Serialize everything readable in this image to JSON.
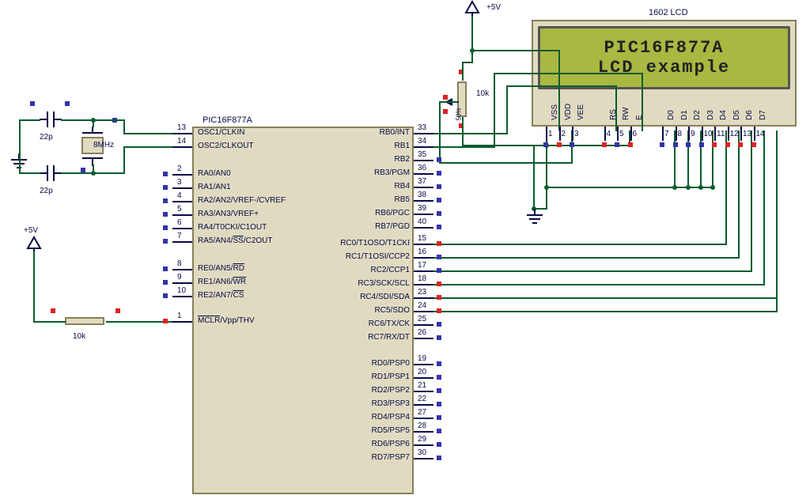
{
  "power": {
    "v5": "+5V"
  },
  "mcu": {
    "title": "PIC16F877A",
    "left_block1": [
      {
        "num": "13",
        "label": "OSC1/CLKIN"
      },
      {
        "num": "14",
        "label": "OSC2/CLKOUT"
      }
    ],
    "left_block2": [
      {
        "num": "2",
        "label": "RA0/AN0"
      },
      {
        "num": "3",
        "label": "RA1/AN1"
      },
      {
        "num": "4",
        "label": "RA2/AN2/VREF-/CVREF"
      },
      {
        "num": "5",
        "label": "RA3/AN3/VREF+"
      },
      {
        "num": "6",
        "label": "RA4/T0CKI/C1OUT"
      },
      {
        "num": "7",
        "label": "RA5/AN4/SS/C2OUT",
        "ss_over": "SS"
      }
    ],
    "left_block3": [
      {
        "num": "8",
        "label": "RE0/AN5/RD",
        "over": "RD"
      },
      {
        "num": "9",
        "label": "RE1/AN6/WR",
        "over": "WR"
      },
      {
        "num": "10",
        "label": "RE2/AN7/CS",
        "over": "CS"
      }
    ],
    "mclr": {
      "num": "1",
      "label": "MCLR/Vpp/THV",
      "over": "MCLR"
    },
    "right_rb": [
      {
        "num": "33",
        "label": "RB0/INT"
      },
      {
        "num": "34",
        "label": "RB1"
      },
      {
        "num": "35",
        "label": "RB2"
      },
      {
        "num": "36",
        "label": "RB3/PGM"
      },
      {
        "num": "37",
        "label": "RB4"
      },
      {
        "num": "38",
        "label": "RB5"
      },
      {
        "num": "39",
        "label": "RB6/PGC"
      },
      {
        "num": "40",
        "label": "RB7/PGD"
      }
    ],
    "right_rc": [
      {
        "num": "15",
        "label": "RC0/T1OSO/T1CKI"
      },
      {
        "num": "16",
        "label": "RC1/T1OSI/CCP2"
      },
      {
        "num": "17",
        "label": "RC2/CCP1"
      },
      {
        "num": "18",
        "label": "RC3/SCK/SCL"
      },
      {
        "num": "23",
        "label": "RC4/SDI/SDA"
      },
      {
        "num": "24",
        "label": "RC5/SDO"
      },
      {
        "num": "25",
        "label": "RC6/TX/CK"
      },
      {
        "num": "26",
        "label": "RC7/RX/DT"
      }
    ],
    "right_rd": [
      {
        "num": "19",
        "label": "RD0/PSP0"
      },
      {
        "num": "20",
        "label": "RD1/PSP1"
      },
      {
        "num": "21",
        "label": "RD2/PSP2"
      },
      {
        "num": "22",
        "label": "RD3/PSP3"
      },
      {
        "num": "27",
        "label": "RD4/PSP4"
      },
      {
        "num": "28",
        "label": "RD5/PSP5"
      },
      {
        "num": "29",
        "label": "RD6/PSP6"
      },
      {
        "num": "30",
        "label": "RD7/PSP7"
      }
    ]
  },
  "lcd": {
    "title": "1602 LCD",
    "line1": "PIC16F877A",
    "line2": "LCD example",
    "pins": [
      {
        "num": "1",
        "name": "VSS"
      },
      {
        "num": "2",
        "name": "VDD"
      },
      {
        "num": "3",
        "name": "VEE"
      },
      {
        "num": "4",
        "name": "RS"
      },
      {
        "num": "5",
        "name": "RW"
      },
      {
        "num": "6",
        "name": "E"
      },
      {
        "num": "7",
        "name": "D0"
      },
      {
        "num": "8",
        "name": "D1"
      },
      {
        "num": "9",
        "name": "D2"
      },
      {
        "num": "10",
        "name": "D3"
      },
      {
        "num": "11",
        "name": "D4"
      },
      {
        "num": "12",
        "name": "D5"
      },
      {
        "num": "13",
        "name": "D6"
      },
      {
        "num": "14",
        "name": "D7"
      }
    ]
  },
  "passives": {
    "c1": "22p",
    "c2": "22p",
    "xtal": "8MHz",
    "r_mclr": "10k",
    "r_pot": "10k",
    "pot_pct": "50%"
  }
}
